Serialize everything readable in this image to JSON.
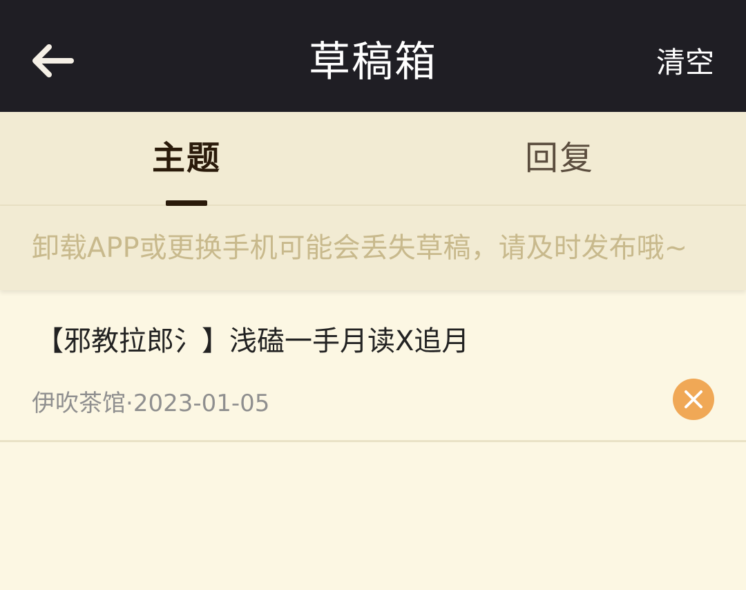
{
  "header": {
    "title": "草稿箱",
    "clear_label": "清空",
    "back_icon": "arrow-left-icon"
  },
  "tabs": [
    {
      "label": "主题",
      "active": true
    },
    {
      "label": "回复",
      "active": false
    }
  ],
  "notice": "卸载APP或更换手机可能会丢失草稿，请及时发布哦~",
  "drafts": [
    {
      "title": "【邪教拉郎氵】浅磕一手月读X追月",
      "forum": "伊吹茶馆",
      "separator": "·",
      "date": "2023-01-05",
      "delete_icon": "close-icon"
    }
  ],
  "colors": {
    "header_bg": "#1f1e24",
    "page_bg": "#fcf7e3",
    "tab_bg": "#f2ebd3",
    "accent_delete": "#f0a856",
    "notice_text": "#c8b98c"
  }
}
